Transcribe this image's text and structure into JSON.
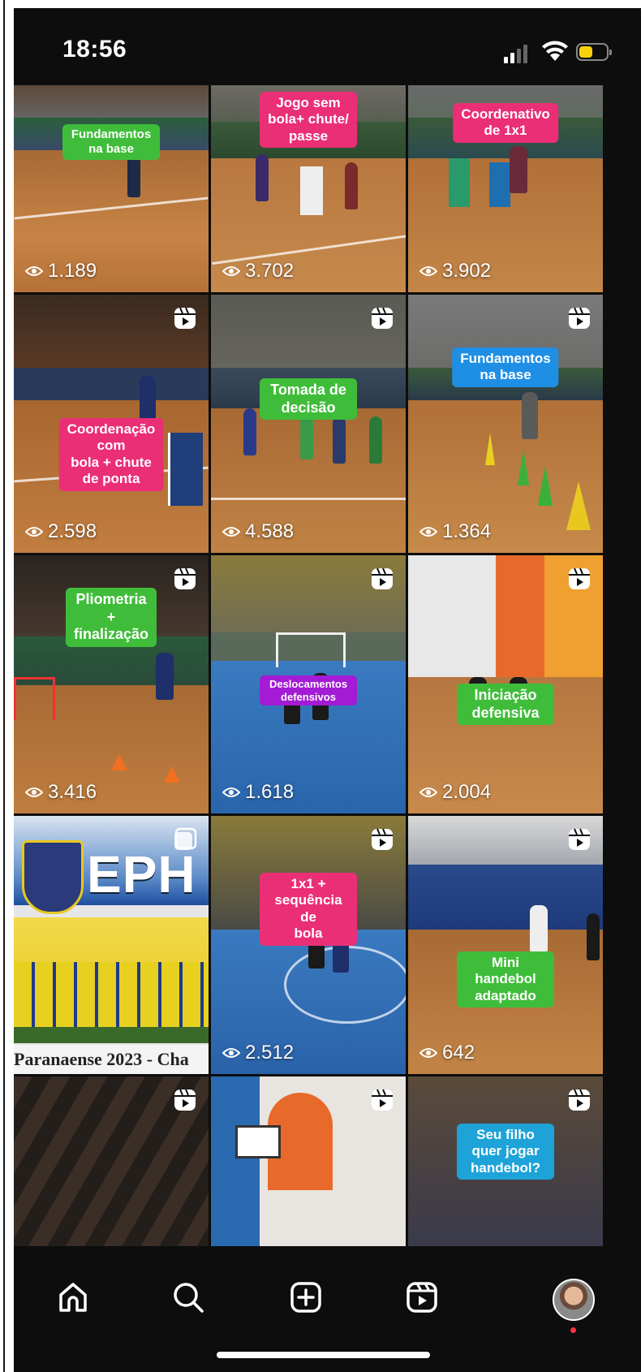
{
  "status_bar": {
    "time": "18:56"
  },
  "colors": {
    "caption_green": "#3fbd3a",
    "caption_pink": "#ea2f76",
    "caption_blue": "#1f8fe5",
    "caption_purple": "#a31bd4",
    "battery_yellow": "#f5d10d",
    "notification_red": "#ff3040"
  },
  "grid": {
    "tiles": [
      {
        "caption": "Fundamentos na base",
        "views": "1.189",
        "reel": false
      },
      {
        "caption": "Jogo sem bola+ chute/\npasse",
        "views": "3.702",
        "reel": false
      },
      {
        "caption": "Coordenativo de 1x1",
        "views": "3.902",
        "reel": false
      },
      {
        "caption": "Coordenação com\nbola + chute de ponta",
        "views": "2.598",
        "reel": true
      },
      {
        "caption": "Tomada de decisão",
        "views": "4.588",
        "reel": true
      },
      {
        "caption": "Fundamentos na base",
        "views": "1.364",
        "reel": true
      },
      {
        "caption": "Pliometria\n+\nfinalização",
        "views": "3.416",
        "reel": true
      },
      {
        "caption": "Deslocamentos defensivos",
        "views": "1.618",
        "reel": true
      },
      {
        "caption": "Iniciação defensiva",
        "views": "2.004",
        "reel": true
      },
      {
        "banner_text": "EPH",
        "footer_text": "Paranaense 2023 - Cha",
        "views": "",
        "carousel": true
      },
      {
        "caption": "1x1 + sequência de\nbola",
        "views": "2.512",
        "reel": true
      },
      {
        "caption": "Mini handebol\nadaptado",
        "views": "642",
        "reel": true
      },
      {
        "caption": "",
        "views": "",
        "reel": true
      },
      {
        "caption": "",
        "views": "",
        "reel": true
      },
      {
        "caption": "Seu filho quer jogar\nhandebol?",
        "views": "",
        "reel": true
      }
    ]
  },
  "nav": {
    "items": [
      "home-icon",
      "search-icon",
      "create-icon",
      "reels-icon",
      "profile-avatar"
    ]
  }
}
